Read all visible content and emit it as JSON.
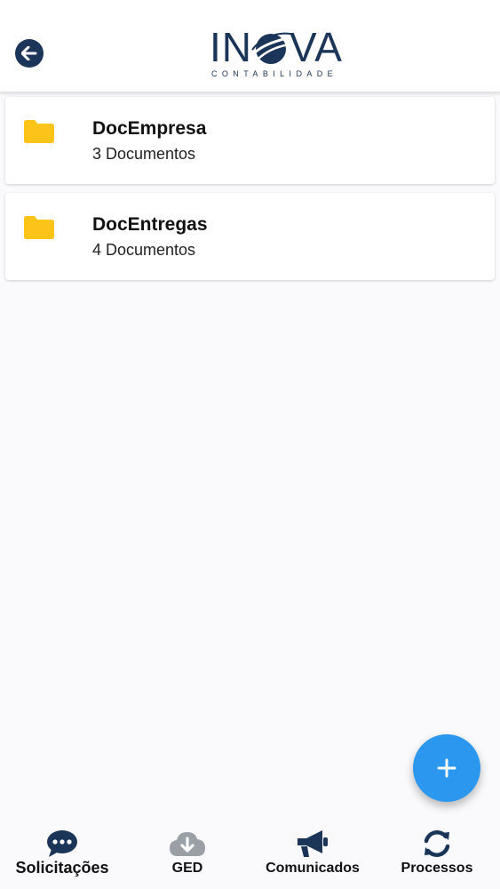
{
  "header": {
    "logo_word_left": "IN",
    "logo_word_right": "VA",
    "logo_subtitle": "CONTABILIDADE",
    "back_icon": "arrow-left-icon",
    "brand_color": "#1a3557"
  },
  "folders": [
    {
      "name": "DocEmpresa",
      "count": "3 Documentos",
      "icon": "folder-icon"
    },
    {
      "name": "DocEntregas",
      "count": "4 Documentos",
      "icon": "folder-icon"
    }
  ],
  "fab": {
    "icon": "plus-icon",
    "color": "#2b97ef"
  },
  "bottom_nav": {
    "items": [
      {
        "label": "Solicitações",
        "icon": "chat-bubble-icon",
        "active": true
      },
      {
        "label": "GED",
        "icon": "cloud-download-icon",
        "active": false
      },
      {
        "label": "Comunicados",
        "icon": "megaphone-icon",
        "active": false
      },
      {
        "label": "Processos",
        "icon": "sync-icon",
        "active": false
      }
    ]
  },
  "colors": {
    "folder": "#fcc419",
    "icon_dark": "#1a3557",
    "icon_muted": "#9aa0a6"
  }
}
